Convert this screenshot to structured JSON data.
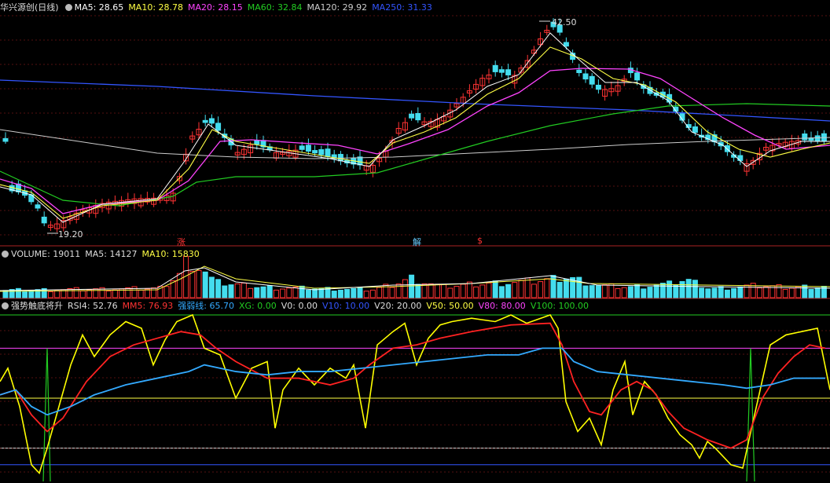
{
  "main": {
    "stock_name": "华兴源创(日线)",
    "menu_icon": "circle-dropdown-icon",
    "indicators": [
      {
        "label": "MA5: 28.65",
        "color": "#ffffff"
      },
      {
        "label": "MA10: 28.78",
        "color": "#ffff44"
      },
      {
        "label": "MA20: 28.15",
        "color": "#ff44ff"
      },
      {
        "label": "MA60: 32.84",
        "color": "#22cc22"
      },
      {
        "label": "MA120: 29.92",
        "color": "#cccccc"
      },
      {
        "label": "MA250: 31.33",
        "color": "#3355ff"
      }
    ],
    "high_label": "42.50",
    "low_label": "19.20",
    "markers": [
      {
        "text": "涨",
        "color": "#ff3333"
      },
      {
        "text": "解",
        "color": "#66ccff"
      },
      {
        "text": "$",
        "color": "#ff3333"
      }
    ]
  },
  "volume": {
    "indicators": [
      {
        "label": "VOLUME: 19011",
        "color": "#dddddd"
      },
      {
        "label": "MA5: 14127",
        "color": "#dddddd"
      },
      {
        "label": "MA10: 15830",
        "color": "#ffff44"
      }
    ]
  },
  "rsi": {
    "indicators": [
      {
        "label": "强势触底将升",
        "color": "#dddddd"
      },
      {
        "label": "RSI4: 52.76",
        "color": "#dddddd"
      },
      {
        "label": "MM5: 76.93",
        "color": "#ff3333"
      },
      {
        "label": "强弱线: 65.70",
        "color": "#33aaff"
      },
      {
        "label": "XG: 0.00",
        "color": "#22cc22"
      },
      {
        "label": "V0: 0.00",
        "color": "#dddddd"
      },
      {
        "label": "V10: 10.00",
        "color": "#3355ff"
      },
      {
        "label": "V20: 20.00",
        "color": "#dddddd"
      },
      {
        "label": "V50: 50.00",
        "color": "#ffff44"
      },
      {
        "label": "V80: 80.00",
        "color": "#ff44ff"
      },
      {
        "label": "V100: 100.00",
        "color": "#22cc22"
      }
    ]
  }
}
